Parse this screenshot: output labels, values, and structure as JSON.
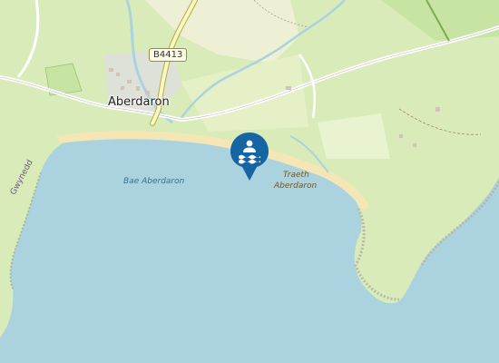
{
  "map": {
    "labels": {
      "town": "Aberdaron",
      "bay": "Bae Aberdaron",
      "beach_line1": "Traeth",
      "beach_line2": "Aberdaron",
      "road_ref": "B4413",
      "boundary": "Gwynedd"
    },
    "marker": {
      "icon": "swimming-icon",
      "color": "#1565a5"
    },
    "colors": {
      "sea": "#aad3df",
      "land": "#d8ebb8",
      "farmland": "#eef0d5",
      "sand": "#f4e6b5",
      "road_yellow": "#f7fabf"
    }
  }
}
